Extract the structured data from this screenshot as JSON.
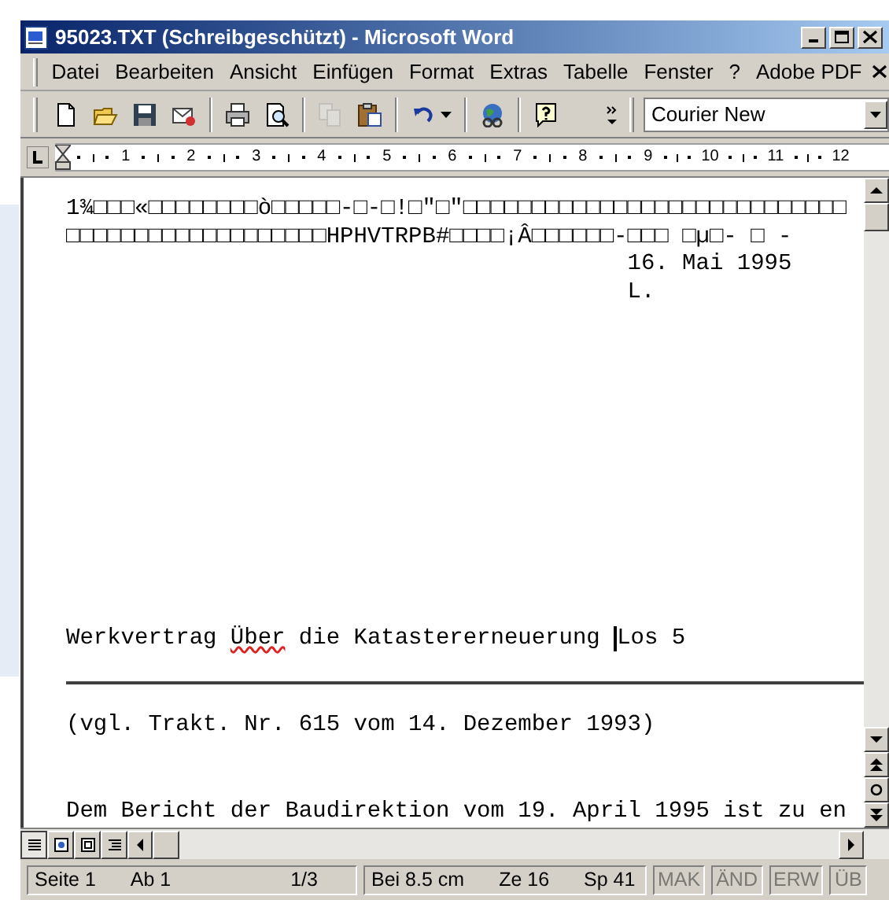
{
  "window": {
    "title": "95023.TXT (Schreibgeschützt) - Microsoft Word"
  },
  "menu": [
    "Datei",
    "Bearbeiten",
    "Ansicht",
    "Einfügen",
    "Format",
    "Extras",
    "Tabelle",
    "Fenster",
    "?",
    "Adobe PDF"
  ],
  "toolbar": {
    "buttons": [
      {
        "kind": "new",
        "disabled": false
      },
      {
        "kind": "open",
        "disabled": false
      },
      {
        "kind": "save",
        "disabled": false
      },
      {
        "kind": "permission",
        "disabled": false
      },
      {
        "kind": "separator"
      },
      {
        "kind": "print",
        "disabled": false
      },
      {
        "kind": "preview",
        "disabled": false
      },
      {
        "kind": "separator"
      },
      {
        "kind": "copy",
        "disabled": true
      },
      {
        "kind": "paste",
        "disabled": false
      },
      {
        "kind": "separator"
      },
      {
        "kind": "undo",
        "disabled": false
      },
      {
        "kind": "separator"
      },
      {
        "kind": "web",
        "disabled": false
      },
      {
        "kind": "separator"
      },
      {
        "kind": "help",
        "disabled": false
      }
    ],
    "font_box": {
      "value": "Courier New"
    }
  },
  "ruler": {
    "labels": [
      "1",
      "2",
      "3",
      "4",
      "5",
      "6",
      "7",
      "8",
      "9",
      "10",
      "11",
      "12"
    ]
  },
  "document": {
    "header_lines": [
      "1¾□□□«□□□□□□□□ò□□□□□-□-□!□\"□\"□□□□□□□□□□□□□□□□□□□□□□□□□□□□",
      "□□□□□□□□□□□□□□□□□□□HPHVTRPB#□□□□¡Â□□□□□□-□□□ □µ□- □ -"
    ],
    "date_lines": [
      "16. Mai 1995",
      "L."
    ],
    "title": [
      {
        "text": "Werkvertrag ",
        "misspelled": false,
        "caret_before": false
      },
      {
        "text": "Über",
        "misspelled": true,
        "caret_before": false
      },
      {
        "text": " die Katastererneuerung ",
        "misspelled": false,
        "caret_before": false
      },
      {
        "text": "Los 5",
        "misspelled": false,
        "caret_before": true
      }
    ],
    "reference": "(vgl. Trakt. Nr. 615 vom 14. Dezember 1993)",
    "body": "Dem Bericht der Baudirektion vom 19. April 1995 ist zu en"
  },
  "status_bar": {
    "panels": [
      [
        "Seite 1",
        "Ab 1",
        "1/3"
      ],
      [
        "Bei 8.5 cm",
        "Ze 16",
        "Sp 41"
      ]
    ],
    "indicators": [
      {
        "label": "MAK",
        "disabled": true
      },
      {
        "label": "ÄND",
        "disabled": true
      },
      {
        "label": "ERW",
        "disabled": true
      },
      {
        "label": "ÜB",
        "disabled": true
      }
    ]
  }
}
